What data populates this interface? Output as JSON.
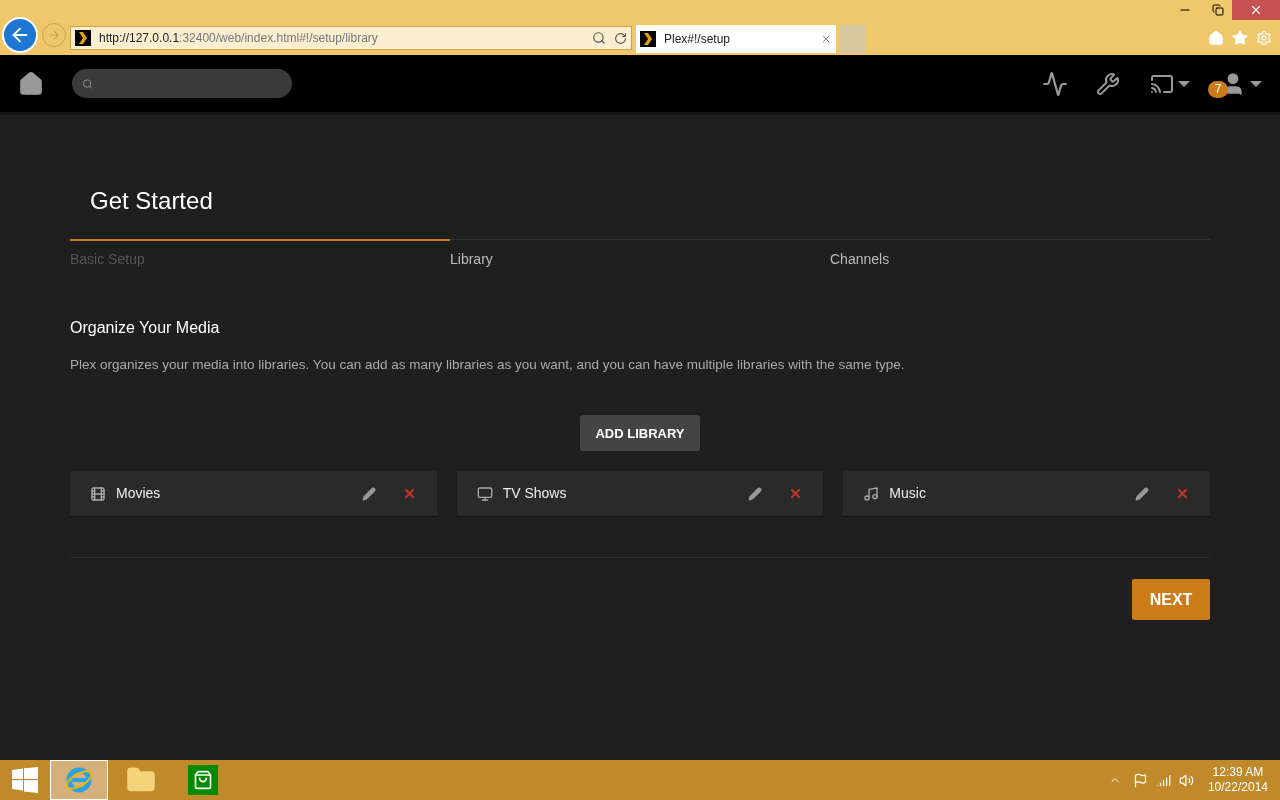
{
  "browser": {
    "address": {
      "host": "http://127.0.0.1",
      "rest": ":32400/web/index.html#!/setup/library"
    },
    "tab": {
      "title": "Plex#!/setup",
      "selected": true
    }
  },
  "header": {
    "badge": "7"
  },
  "title": "Get Started",
  "steps": [
    {
      "label": "Basic Setup",
      "completed": true
    },
    {
      "label": "Library",
      "completed": false
    },
    {
      "label": "Channels",
      "completed": false
    }
  ],
  "section": {
    "title": "Organize Your Media",
    "description": "Plex organizes your media into libraries. You can add as many libraries as you want, and you can have multiple libraries with the same type."
  },
  "add_button": "ADD LIBRARY",
  "libraries": [
    {
      "kind": "movies",
      "name": "Movies"
    },
    {
      "kind": "tv",
      "name": "TV Shows"
    },
    {
      "kind": "music",
      "name": "Music"
    }
  ],
  "next_button": "NEXT",
  "taskbar": {
    "time": "12:39 AM",
    "date": "10/22/2014",
    "apps": [
      {
        "kind": "ie",
        "selected": true
      },
      {
        "kind": "explorer",
        "selected": false
      },
      {
        "kind": "store",
        "selected": false
      }
    ]
  }
}
